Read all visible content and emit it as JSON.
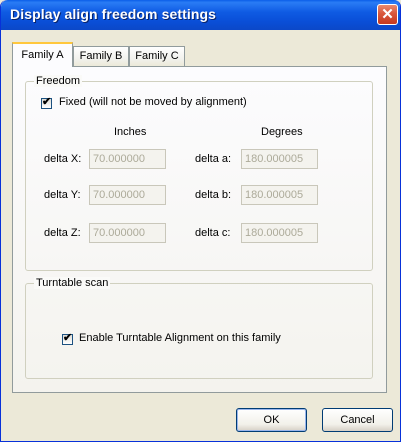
{
  "window": {
    "title": "Display align freedom settings",
    "close_glyph": "✕"
  },
  "tabs": [
    {
      "label": "Family A",
      "active": true
    },
    {
      "label": "Family B",
      "active": false
    },
    {
      "label": "Family C",
      "active": false
    }
  ],
  "freedom": {
    "group_label": "Freedom",
    "fixed_checkbox": {
      "label": "Fixed (will not be moved by alignment)",
      "checked": true
    },
    "inches_header": "Inches",
    "degrees_header": "Degrees",
    "rows": [
      {
        "linear_label": "delta X:",
        "linear_value": "70.000000",
        "angular_label": "delta a:",
        "angular_value": "180.000005"
      },
      {
        "linear_label": "delta Y:",
        "linear_value": "70.000000",
        "angular_label": "delta b:",
        "angular_value": "180.000005"
      },
      {
        "linear_label": "delta Z:",
        "linear_value": "70.000000",
        "angular_label": "delta c:",
        "angular_value": "180.000005"
      }
    ]
  },
  "turntable": {
    "group_label": "Turntable scan",
    "enable_checkbox": {
      "label": "Enable Turntable Alignment on this family",
      "checked": true
    }
  },
  "buttons": {
    "ok": "OK",
    "cancel": "Cancel"
  },
  "check_glyph": "✔"
}
